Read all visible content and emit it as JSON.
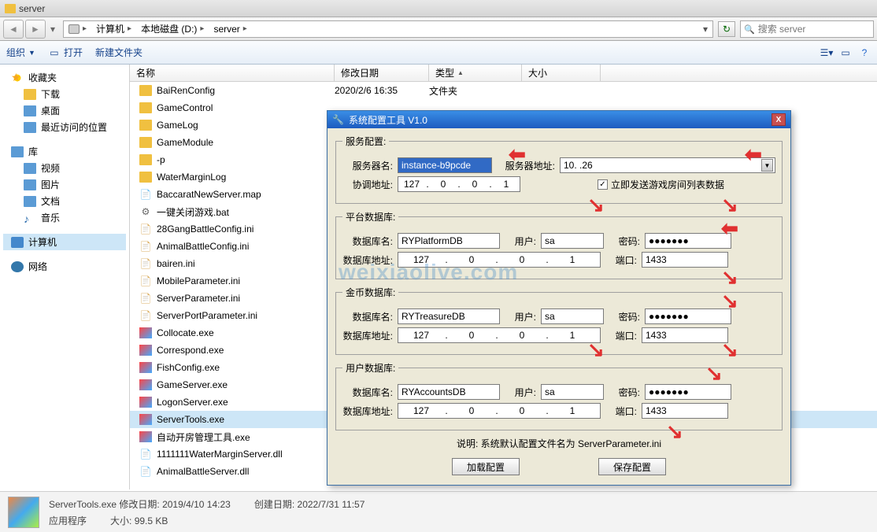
{
  "titlebar": {
    "title": "server"
  },
  "address": {
    "segments": [
      "计算机",
      "本地磁盘 (D:)",
      "server"
    ]
  },
  "search": {
    "placeholder": "搜索 server"
  },
  "toolbar": {
    "organize": "组织",
    "open": "打开",
    "newfolder": "新建文件夹"
  },
  "sidebar": {
    "fav": "收藏夹",
    "downloads": "下载",
    "desktop": "桌面",
    "recent": "最近访问的位置",
    "library": "库",
    "videos": "视频",
    "pictures": "图片",
    "documents": "文档",
    "music": "音乐",
    "computer": "计算机",
    "network": "网络"
  },
  "columns": {
    "name": "名称",
    "date": "修改日期",
    "type": "类型",
    "size": "大小"
  },
  "files": [
    {
      "n": "BaiRenConfig",
      "d": "2020/2/6 16:35",
      "t": "文件夹",
      "ico": "folder"
    },
    {
      "n": "GameControl",
      "d": "",
      "t": "",
      "ico": "folder"
    },
    {
      "n": "GameLog",
      "d": "",
      "t": "",
      "ico": "folder"
    },
    {
      "n": "GameModule",
      "d": "",
      "t": "",
      "ico": "folder"
    },
    {
      "n": "-p",
      "d": "",
      "t": "",
      "ico": "folder"
    },
    {
      "n": "WaterMarginLog",
      "d": "",
      "t": "",
      "ico": "folder"
    },
    {
      "n": "BaccaratNewServer.map",
      "d": "",
      "t": "",
      "ico": "map"
    },
    {
      "n": "一键关闭游戏.bat",
      "d": "",
      "t": "",
      "ico": "bat"
    },
    {
      "n": "28GangBattleConfig.ini",
      "d": "",
      "t": "",
      "ico": "ini"
    },
    {
      "n": "AnimalBattleConfig.ini",
      "d": "",
      "t": "",
      "ico": "ini"
    },
    {
      "n": "bairen.ini",
      "d": "",
      "t": "",
      "ico": "ini"
    },
    {
      "n": "MobileParameter.ini",
      "d": "",
      "t": "",
      "ico": "ini"
    },
    {
      "n": "ServerParameter.ini",
      "d": "",
      "t": "",
      "ico": "ini"
    },
    {
      "n": "ServerPortParameter.ini",
      "d": "",
      "t": "",
      "ico": "ini"
    },
    {
      "n": "Collocate.exe",
      "d": "",
      "t": "",
      "ico": "exe"
    },
    {
      "n": "Correspond.exe",
      "d": "",
      "t": "",
      "ico": "exe"
    },
    {
      "n": "FishConfig.exe",
      "d": "",
      "t": "",
      "ico": "exe"
    },
    {
      "n": "GameServer.exe",
      "d": "",
      "t": "",
      "ico": "exe"
    },
    {
      "n": "LogonServer.exe",
      "d": "",
      "t": "",
      "ico": "exe"
    },
    {
      "n": "ServerTools.exe",
      "d": "",
      "t": "",
      "ico": "exe",
      "sel": true
    },
    {
      "n": "自动开房管理工具.exe",
      "d": "",
      "t": "",
      "ico": "exe"
    },
    {
      "n": "1111111WaterMarginServer.dll",
      "d": "",
      "t": "",
      "ico": "dll"
    },
    {
      "n": "AnimalBattleServer.dll",
      "d": "",
      "t": "",
      "ico": "dll"
    }
  ],
  "dialog": {
    "title": "系统配置工具 V1.0",
    "grp_service": "服务配置:",
    "lbl_servername": "服务器名:",
    "val_servername": "instance-b9pcde",
    "lbl_serveraddr": "服务器地址:",
    "val_serveraddr": "10.         .26",
    "lbl_coord": "协调地址:",
    "ip_coord": [
      "127",
      "0",
      "0",
      "1"
    ],
    "chk_send": "立即发送游戏房间列表数据",
    "grp_platform": "平台数据库:",
    "grp_gold": "金币数据库:",
    "grp_user": "用户数据库:",
    "lbl_dbname": "数据库名:",
    "lbl_user": "用户:",
    "lbl_pwd": "密码:",
    "lbl_dbaddr": "数据库地址:",
    "lbl_port": "端口:",
    "db_platform_name": "RYPlatformDB",
    "db_gold_name": "RYTreasureDB",
    "db_user_name": "RYAccountsDB",
    "db_user_val": "sa",
    "db_pwd_val": "●●●●●●●",
    "db_ip": [
      "127",
      "0",
      "0",
      "1"
    ],
    "db_port": "1433",
    "note": "说明:  系统默认配置文件名为 ServerParameter.ini",
    "btn_load": "加载配置",
    "btn_save": "保存配置"
  },
  "status": {
    "file": "ServerTools.exe",
    "mdate_lbl": "修改日期:",
    "mdate": "2019/4/10 14:23",
    "cdate_lbl": "创建日期:",
    "cdate": "2022/7/31 11:57",
    "type": "应用程序",
    "size_lbl": "大小:",
    "size": "99.5 KB"
  },
  "watermark": "weixiaolive.com"
}
